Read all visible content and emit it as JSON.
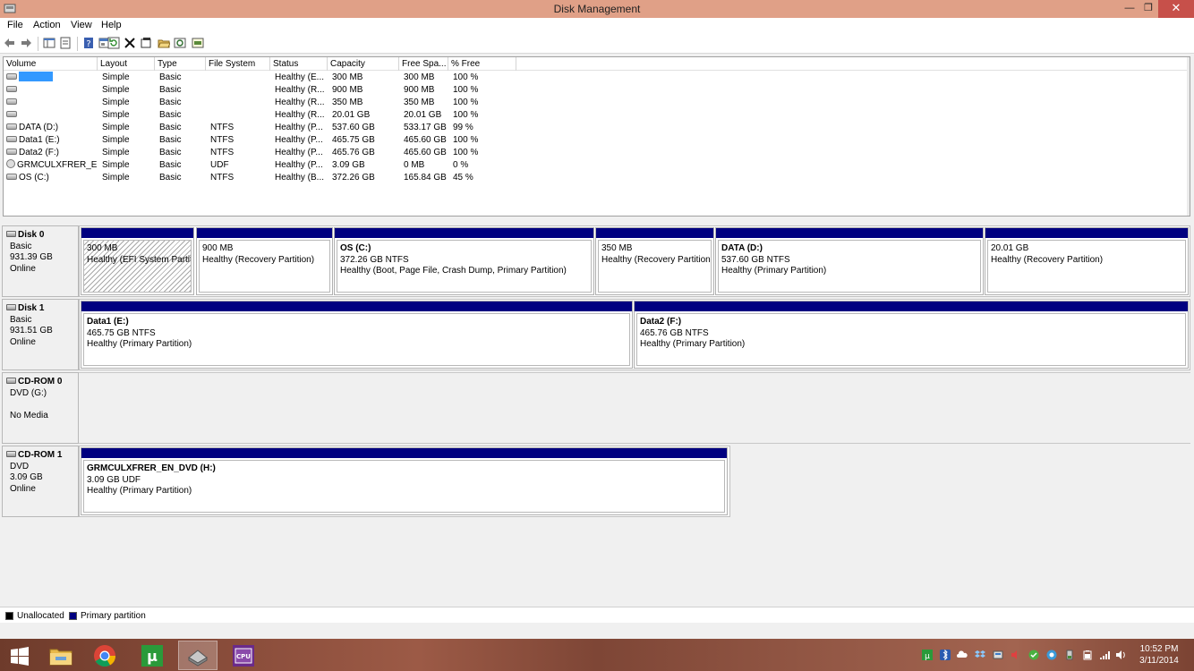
{
  "window": {
    "title": "Disk Management"
  },
  "menu": [
    "File",
    "Action",
    "View",
    "Help"
  ],
  "volume_list": {
    "columns": [
      "Volume",
      "Layout",
      "Type",
      "File System",
      "Status",
      "Capacity",
      "Free Spa...",
      "% Free"
    ],
    "rows": [
      {
        "volume": "",
        "layout": "Simple",
        "type": "Basic",
        "fs": "",
        "status": "Healthy (E...",
        "capacity": "300 MB",
        "free": "300 MB",
        "pct": "100 %"
      },
      {
        "volume": "",
        "layout": "Simple",
        "type": "Basic",
        "fs": "",
        "status": "Healthy (R...",
        "capacity": "900 MB",
        "free": "900 MB",
        "pct": "100 %"
      },
      {
        "volume": "",
        "layout": "Simple",
        "type": "Basic",
        "fs": "",
        "status": "Healthy (R...",
        "capacity": "350 MB",
        "free": "350 MB",
        "pct": "100 %"
      },
      {
        "volume": "",
        "layout": "Simple",
        "type": "Basic",
        "fs": "",
        "status": "Healthy (R...",
        "capacity": "20.01 GB",
        "free": "20.01 GB",
        "pct": "100 %"
      },
      {
        "volume": "DATA (D:)",
        "layout": "Simple",
        "type": "Basic",
        "fs": "NTFS",
        "status": "Healthy (P...",
        "capacity": "537.60 GB",
        "free": "533.17 GB",
        "pct": "99 %"
      },
      {
        "volume": "Data1 (E:)",
        "layout": "Simple",
        "type": "Basic",
        "fs": "NTFS",
        "status": "Healthy (P...",
        "capacity": "465.75 GB",
        "free": "465.60 GB",
        "pct": "100 %"
      },
      {
        "volume": "Data2 (F:)",
        "layout": "Simple",
        "type": "Basic",
        "fs": "NTFS",
        "status": "Healthy (P...",
        "capacity": "465.76 GB",
        "free": "465.60 GB",
        "pct": "100 %"
      },
      {
        "volume": "GRMCULXFRER_E...",
        "layout": "Simple",
        "type": "Basic",
        "fs": "UDF",
        "status": "Healthy (P...",
        "capacity": "3.09 GB",
        "free": "0 MB",
        "pct": "0 %"
      },
      {
        "volume": "OS (C:)",
        "layout": "Simple",
        "type": "Basic",
        "fs": "NTFS",
        "status": "Healthy (B...",
        "capacity": "372.26 GB",
        "free": "165.84 GB",
        "pct": "45 %"
      }
    ]
  },
  "disks": [
    {
      "name": "Disk 0",
      "kind": "Basic",
      "size": "931.39 GB",
      "state": "Online",
      "partitions": [
        {
          "name": "",
          "size": "300 MB",
          "status": "Healthy (EFI System Partiti"
        },
        {
          "name": "",
          "size": "900 MB",
          "status": "Healthy (Recovery Partition)"
        },
        {
          "name": "OS  (C:)",
          "size": "372.26 GB NTFS",
          "status": "Healthy (Boot, Page File, Crash Dump, Primary Partition)"
        },
        {
          "name": "",
          "size": "350 MB",
          "status": "Healthy (Recovery Partition"
        },
        {
          "name": "DATA  (D:)",
          "size": "537.60 GB NTFS",
          "status": "Healthy (Primary Partition)"
        },
        {
          "name": "",
          "size": "20.01 GB",
          "status": "Healthy (Recovery Partition)"
        }
      ]
    },
    {
      "name": "Disk 1",
      "kind": "Basic",
      "size": "931.51 GB",
      "state": "Online",
      "partitions": [
        {
          "name": "Data1  (E:)",
          "size": "465.75 GB NTFS",
          "status": "Healthy (Primary Partition)"
        },
        {
          "name": "Data2  (F:)",
          "size": "465.76 GB NTFS",
          "status": "Healthy (Primary Partition)"
        }
      ]
    },
    {
      "name": "CD-ROM 0",
      "kind": "DVD (G:)",
      "size": "",
      "state": "No Media",
      "partitions": []
    },
    {
      "name": "CD-ROM 1",
      "kind": "DVD",
      "size": "3.09 GB",
      "state": "Online",
      "partitions": [
        {
          "name": "GRMCULXFRER_EN_DVD  (H:)",
          "size": "3.09 GB UDF",
          "status": "Healthy (Primary Partition)"
        }
      ]
    }
  ],
  "legend": {
    "unallocated": "Unallocated",
    "primary": "Primary partition"
  },
  "colors": {
    "primary_partition": "#000080",
    "unallocated": "#000000",
    "titlebar": "#e0a087",
    "close_button": "#c7504a"
  },
  "taskbar": {
    "apps": [
      "windows-start-icon",
      "file-explorer-icon",
      "chrome-icon",
      "utorrent-icon",
      "disk-management-icon",
      "cpuz-icon"
    ],
    "clock": {
      "time": "10:52 PM",
      "date": "3/11/2014"
    }
  }
}
